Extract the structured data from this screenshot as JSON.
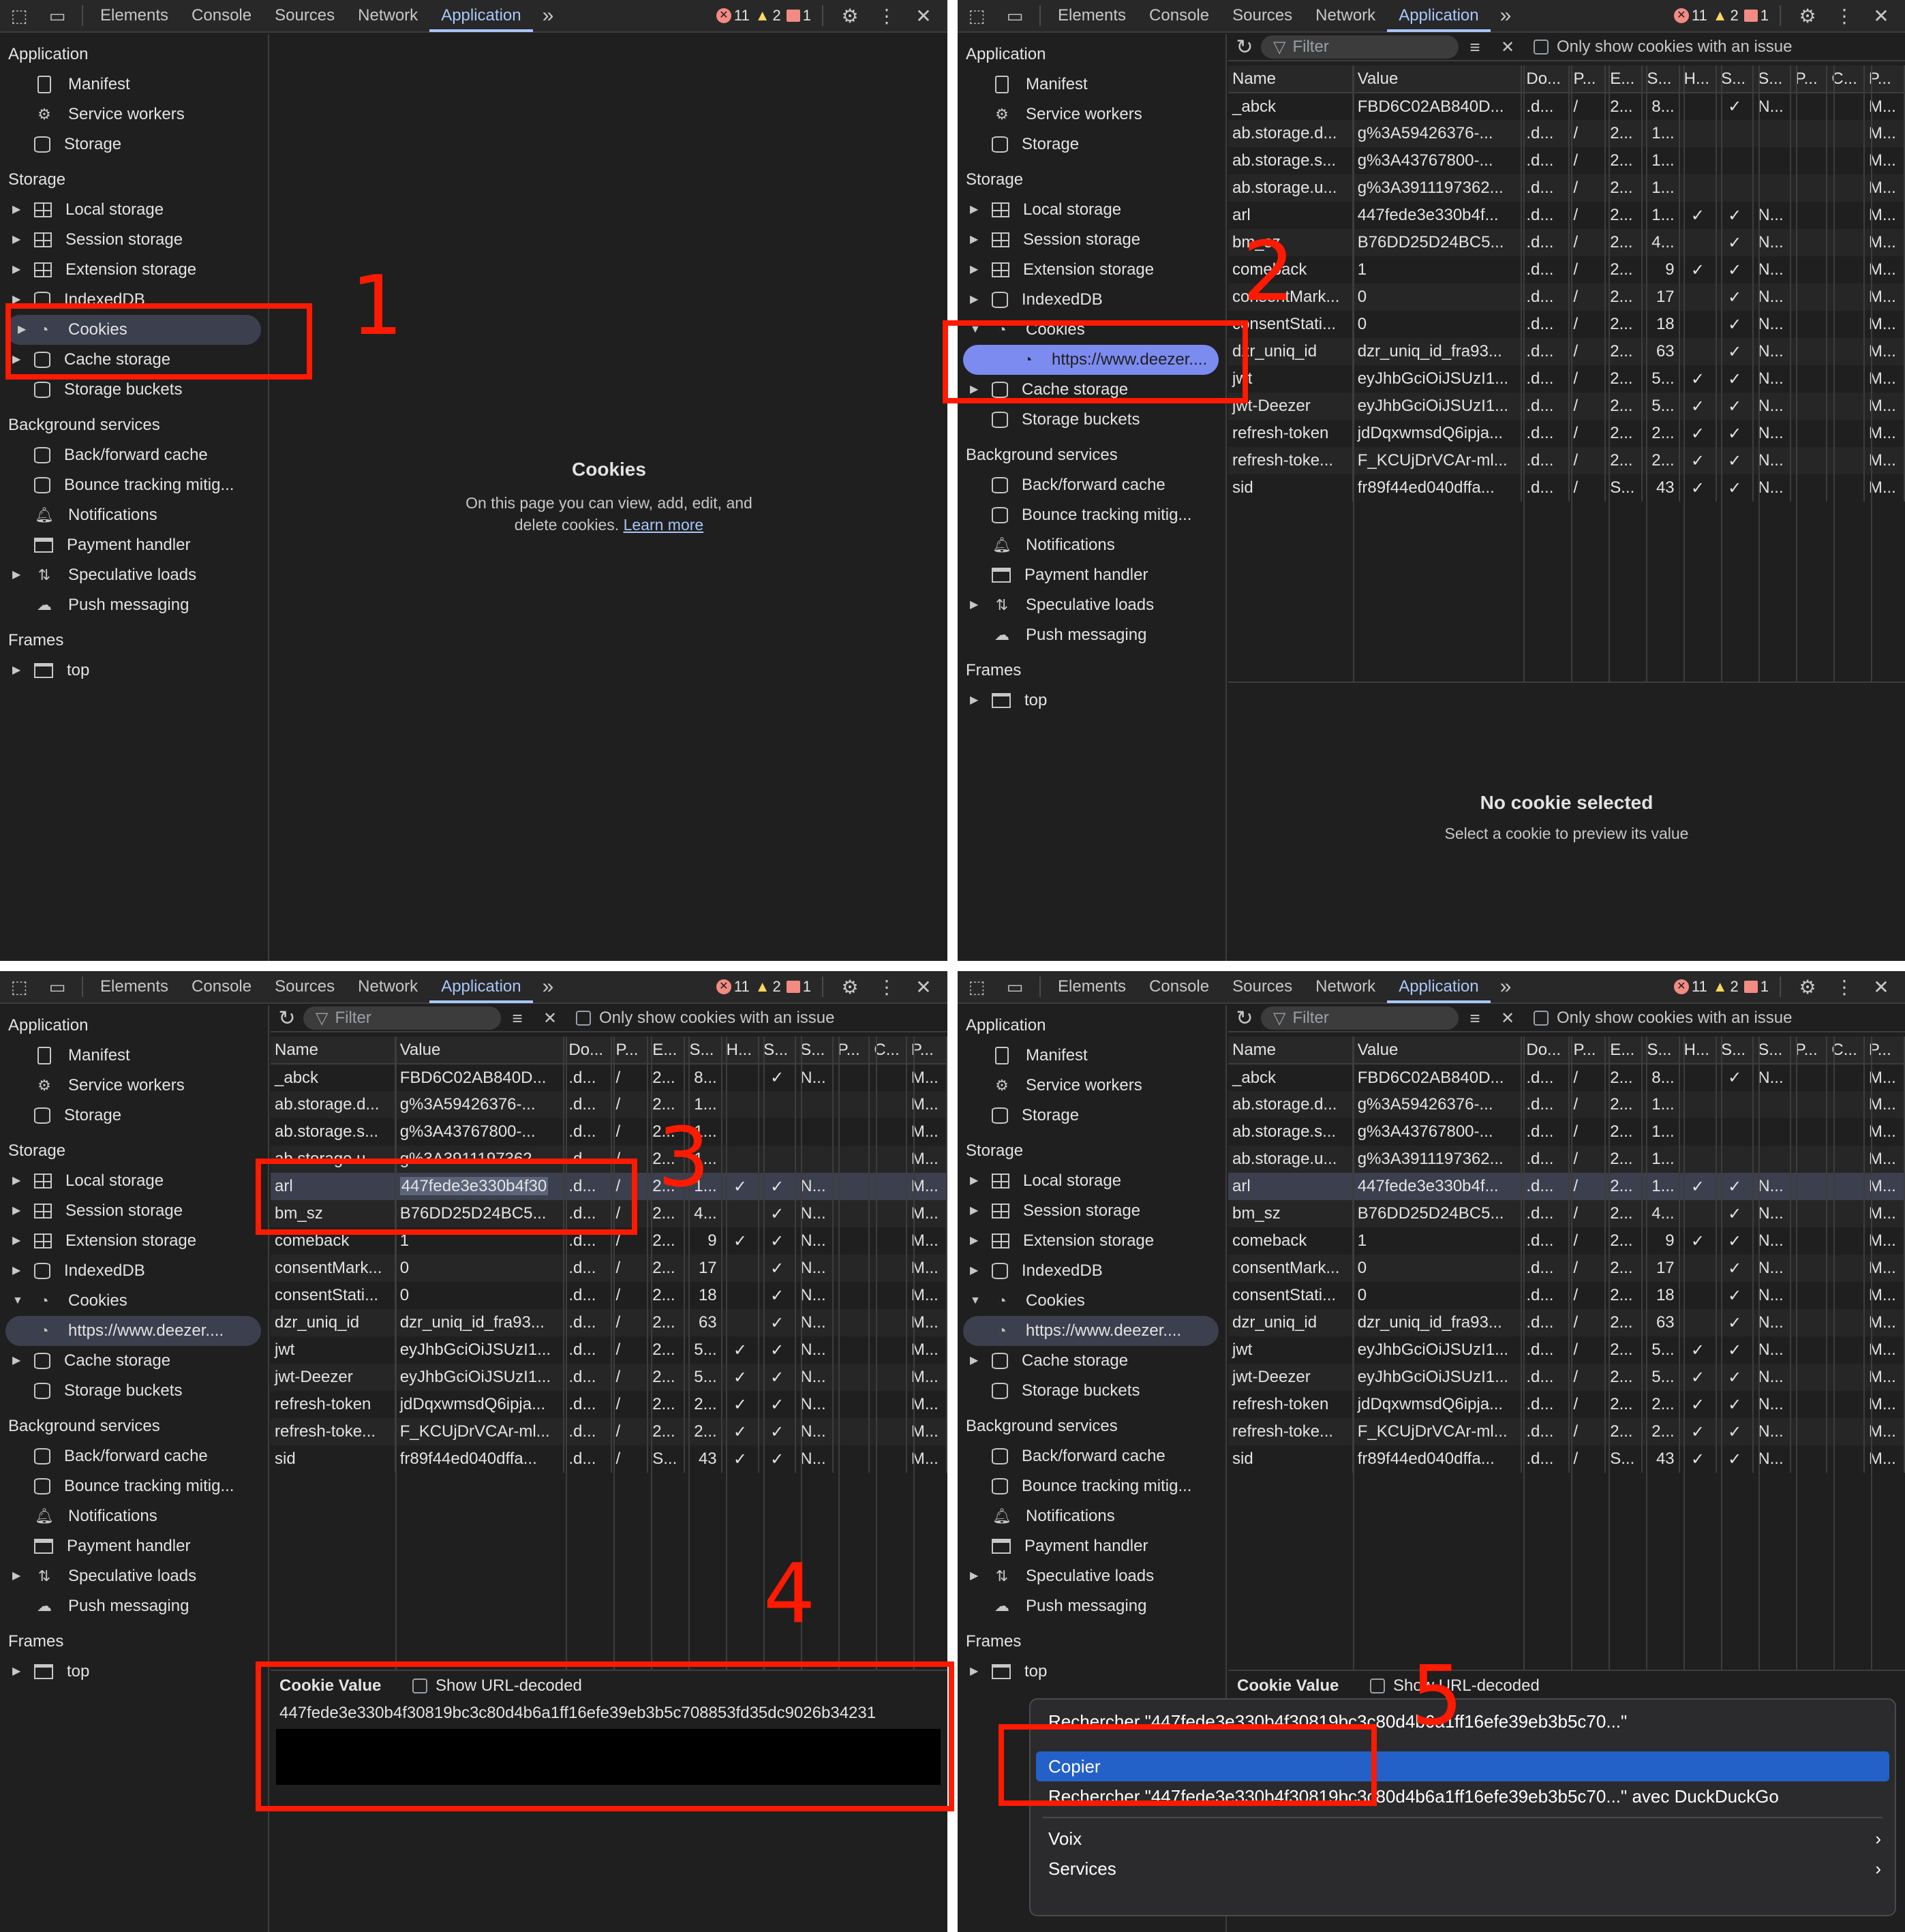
{
  "tabs": {
    "elements": "Elements",
    "console": "Console",
    "sources": "Sources",
    "network": "Network",
    "application": "Application"
  },
  "badges": {
    "errors": "11",
    "warnings": "2",
    "issues": "1"
  },
  "sidebar": {
    "application_header": "Application",
    "manifest": "Manifest",
    "service_workers": "Service workers",
    "storage_item": "Storage",
    "storage_header": "Storage",
    "local_storage": "Local storage",
    "session_storage": "Session storage",
    "extension_storage": "Extension storage",
    "indexeddb": "IndexedDB",
    "cookies": "Cookies",
    "cookie_origin": "https://www.deezer....",
    "cache_storage": "Cache storage",
    "storage_buckets": "Storage buckets",
    "bg_header": "Background services",
    "bfcache": "Back/forward cache",
    "bounce": "Bounce tracking mitig...",
    "notifications": "Notifications",
    "payment": "Payment handler",
    "speculative": "Speculative loads",
    "push": "Push messaging",
    "frames_header": "Frames",
    "top": "top"
  },
  "empty_cookies": {
    "title": "Cookies",
    "line1": "On this page you can view, add, edit, and",
    "line2": "delete cookies.",
    "learn_more": "Learn more"
  },
  "toolbar": {
    "filter_placeholder": "Filter",
    "only_issue": "Only show cookies with an issue"
  },
  "table": {
    "columns": [
      "Name",
      "Value",
      "Do...",
      "P...",
      "E...",
      "S...",
      "H...",
      "S...",
      "S...",
      "P...",
      "C...",
      "P..."
    ],
    "rows": [
      {
        "name": "_abck",
        "value": "FBD6C02AB840D...",
        "domain": ".d...",
        "path": "/",
        "expires": "2...",
        "size": "8...",
        "http": "",
        "secure": "✓",
        "samesite": "N...",
        "partition": "",
        "crosssite": "",
        "priority": "M..."
      },
      {
        "name": "ab.storage.d...",
        "value": "g%3A59426376-...",
        "domain": ".d...",
        "path": "/",
        "expires": "2...",
        "size": "1...",
        "http": "",
        "secure": "",
        "samesite": "",
        "partition": "",
        "crosssite": "",
        "priority": "M..."
      },
      {
        "name": "ab.storage.s...",
        "value": "g%3A43767800-...",
        "domain": ".d...",
        "path": "/",
        "expires": "2...",
        "size": "1...",
        "http": "",
        "secure": "",
        "samesite": "",
        "partition": "",
        "crosssite": "",
        "priority": "M..."
      },
      {
        "name": "ab.storage.u...",
        "value": "g%3A3911197362...",
        "domain": ".d...",
        "path": "/",
        "expires": "2...",
        "size": "1...",
        "http": "",
        "secure": "",
        "samesite": "",
        "partition": "",
        "crosssite": "",
        "priority": "M..."
      },
      {
        "name": "arl",
        "value": "447fede3e330b4f...",
        "domain": ".d...",
        "path": "/",
        "expires": "2...",
        "size": "1...",
        "http": "✓",
        "secure": "✓",
        "samesite": "N...",
        "partition": "",
        "crosssite": "",
        "priority": "M..."
      },
      {
        "name": "bm_sz",
        "value": "B76DD25D24BC5...",
        "domain": ".d...",
        "path": "/",
        "expires": "2...",
        "size": "4...",
        "http": "",
        "secure": "✓",
        "samesite": "N...",
        "partition": "",
        "crosssite": "",
        "priority": "M..."
      },
      {
        "name": "comeback",
        "value": "1",
        "domain": ".d...",
        "path": "/",
        "expires": "2...",
        "size": "9",
        "http": "✓",
        "secure": "✓",
        "samesite": "N...",
        "partition": "",
        "crosssite": "",
        "priority": "M..."
      },
      {
        "name": "consentMark...",
        "value": "0",
        "domain": ".d...",
        "path": "/",
        "expires": "2...",
        "size": "17",
        "http": "",
        "secure": "✓",
        "samesite": "N...",
        "partition": "",
        "crosssite": "",
        "priority": "M..."
      },
      {
        "name": "consentStati...",
        "value": "0",
        "domain": ".d...",
        "path": "/",
        "expires": "2...",
        "size": "18",
        "http": "",
        "secure": "✓",
        "samesite": "N...",
        "partition": "",
        "crosssite": "",
        "priority": "M..."
      },
      {
        "name": "dzr_uniq_id",
        "value": "dzr_uniq_id_fra93...",
        "domain": ".d...",
        "path": "/",
        "expires": "2...",
        "size": "63",
        "http": "",
        "secure": "✓",
        "samesite": "N...",
        "partition": "",
        "crosssite": "",
        "priority": "M..."
      },
      {
        "name": "jwt",
        "value": "eyJhbGciOiJSUzI1...",
        "domain": ".d...",
        "path": "/",
        "expires": "2...",
        "size": "5...",
        "http": "✓",
        "secure": "✓",
        "samesite": "N...",
        "partition": "",
        "crosssite": "",
        "priority": "M..."
      },
      {
        "name": "jwt-Deezer",
        "value": "eyJhbGciOiJSUzI1...",
        "domain": ".d...",
        "path": "/",
        "expires": "2...",
        "size": "5...",
        "http": "✓",
        "secure": "✓",
        "samesite": "N...",
        "partition": "",
        "crosssite": "",
        "priority": "M..."
      },
      {
        "name": "refresh-token",
        "value": "jdDqxwmsdQ6ipja...",
        "domain": ".d...",
        "path": "/",
        "expires": "2...",
        "size": "2...",
        "http": "✓",
        "secure": "✓",
        "samesite": "N...",
        "partition": "",
        "crosssite": "",
        "priority": "M..."
      },
      {
        "name": "refresh-toke...",
        "value": "F_KCUjDrVCAr-ml...",
        "domain": ".d...",
        "path": "/",
        "expires": "2...",
        "size": "2...",
        "http": "✓",
        "secure": "✓",
        "samesite": "N...",
        "partition": "",
        "crosssite": "",
        "priority": "M..."
      },
      {
        "name": "sid",
        "value": "fr89f44ed040dffa...",
        "domain": ".d...",
        "path": "/",
        "expires": "S...",
        "size": "43",
        "http": "✓",
        "secure": "✓",
        "samesite": "N...",
        "partition": "",
        "crosssite": "",
        "priority": "M..."
      }
    ],
    "selected_value_p3": "447fede3e330b4f30"
  },
  "no_cookie": {
    "title": "No cookie selected",
    "subtitle": "Select a cookie to preview its value"
  },
  "cookie_value": {
    "label": "Cookie Value",
    "show_decoded": "Show URL-decoded",
    "value": "447fede3e330b4f30819bc3c80d4b6a1ff16efe39eb3b5c708853fd35dc9026b34231"
  },
  "context_menu": {
    "search": "Rechercher \"447fede3e330b4f30819bc3c80d4b6a1ff16efe39eb3b5c70...\"",
    "copy": "Copier",
    "search_ddg": "Rechercher \"447fede3e330b4f30819bc3c80d4b6a1ff16efe39eb3b5c70...\" avec DuckDuckGo",
    "voice": "Voix",
    "services": "Services"
  },
  "steps": [
    "1",
    "2",
    "3",
    "4",
    "5"
  ],
  "colors": {
    "annotation": "#ff1a00",
    "selection": "#7c8bef",
    "menu_highlight": "#2361c8"
  }
}
